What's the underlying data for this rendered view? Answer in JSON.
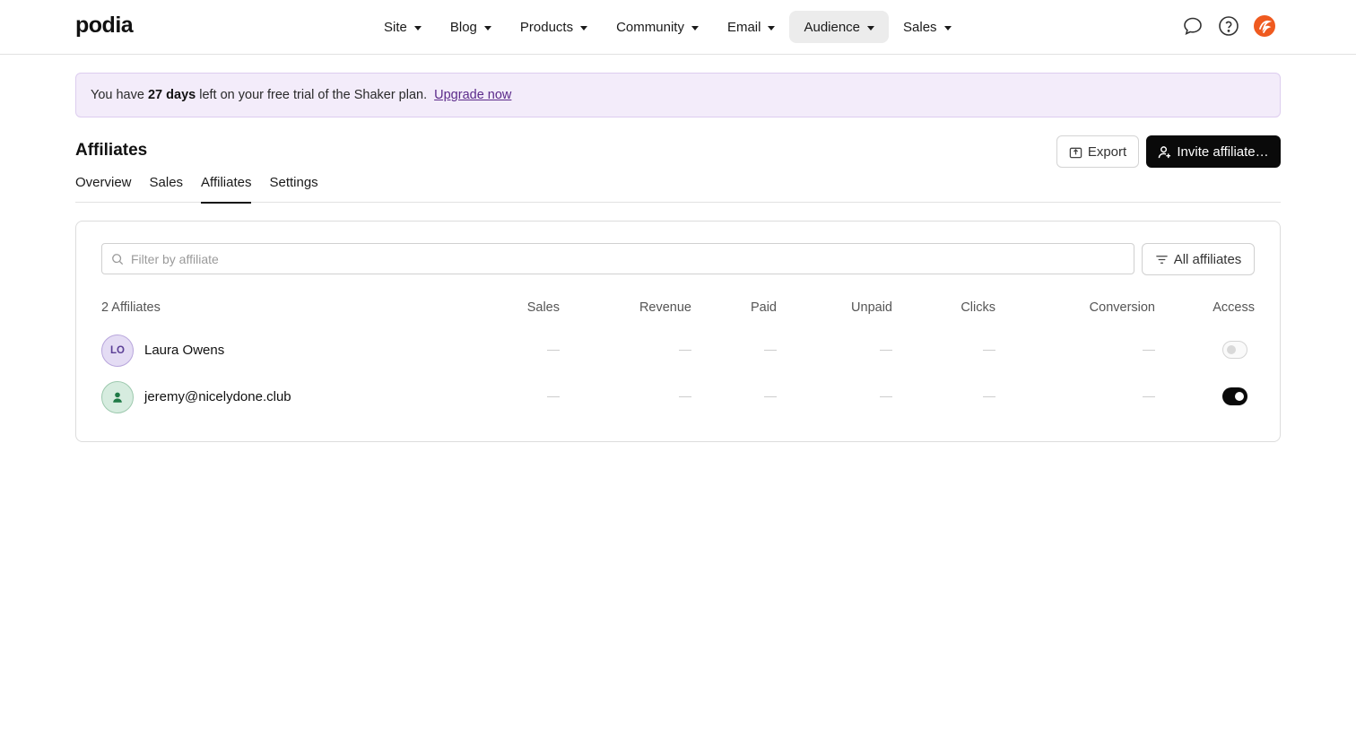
{
  "brand": {
    "logo": "podia",
    "accent": "#0a0a0a",
    "banner_bg": "#f3ecfa",
    "link_color": "#5b2a8a"
  },
  "nav": {
    "items": [
      {
        "label": "Site",
        "active": false
      },
      {
        "label": "Blog",
        "active": false
      },
      {
        "label": "Products",
        "active": false
      },
      {
        "label": "Community",
        "active": false
      },
      {
        "label": "Email",
        "active": false
      },
      {
        "label": "Audience",
        "active": true
      },
      {
        "label": "Sales",
        "active": false
      }
    ],
    "icons": [
      "chat-icon",
      "help-icon",
      "profile-avatar-icon"
    ]
  },
  "banner": {
    "prefix": "You have",
    "days": "27 days",
    "suffix": "left on your free trial of the Shaker plan.",
    "link": "Upgrade now"
  },
  "page": {
    "title": "Affiliates",
    "export_label": "Export",
    "invite_label": "Invite affiliate…",
    "tabs": [
      {
        "label": "Overview",
        "active": false
      },
      {
        "label": "Sales",
        "active": false
      },
      {
        "label": "Affiliates",
        "active": true
      },
      {
        "label": "Settings",
        "active": false
      }
    ]
  },
  "filter": {
    "placeholder": "Filter by affiliate",
    "value": "",
    "dropdown_label": "All affiliates"
  },
  "table": {
    "count_label": "2 Affiliates",
    "headers": {
      "sales": "Sales",
      "revenue": "Revenue",
      "paid": "Paid",
      "unpaid": "Unpaid",
      "clicks": "Clicks",
      "conversion": "Conversion",
      "access": "Access"
    },
    "rows": [
      {
        "initials": "LO",
        "avatar_type": "initials",
        "name": "Laura Owens",
        "sales": "—",
        "revenue": "—",
        "paid": "—",
        "unpaid": "—",
        "clicks": "—",
        "conversion": "—",
        "access": false
      },
      {
        "initials": "",
        "avatar_type": "user-icon",
        "name": "jeremy@nicelydone.club",
        "sales": "—",
        "revenue": "—",
        "paid": "—",
        "unpaid": "—",
        "clicks": "—",
        "conversion": "—",
        "access": true
      }
    ]
  }
}
